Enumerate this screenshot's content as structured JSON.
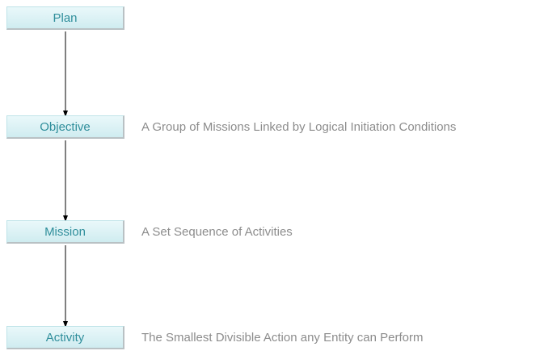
{
  "diagram": {
    "levels": [
      {
        "label": "Plan",
        "description": ""
      },
      {
        "label": "Objective",
        "description": "A Group of Missions Linked by Logical Initiation Conditions"
      },
      {
        "label": "Mission",
        "description": "A Set Sequence of Activities"
      },
      {
        "label": "Activity",
        "description": "The Smallest Divisible Action any Entity can Perform"
      }
    ]
  },
  "colors": {
    "node_text": "#2f8e9b",
    "node_fill_top": "#eaf8fa",
    "node_fill_bottom": "#cfecf0",
    "description_text": "#8c8c8c",
    "connector": "#000000"
  }
}
